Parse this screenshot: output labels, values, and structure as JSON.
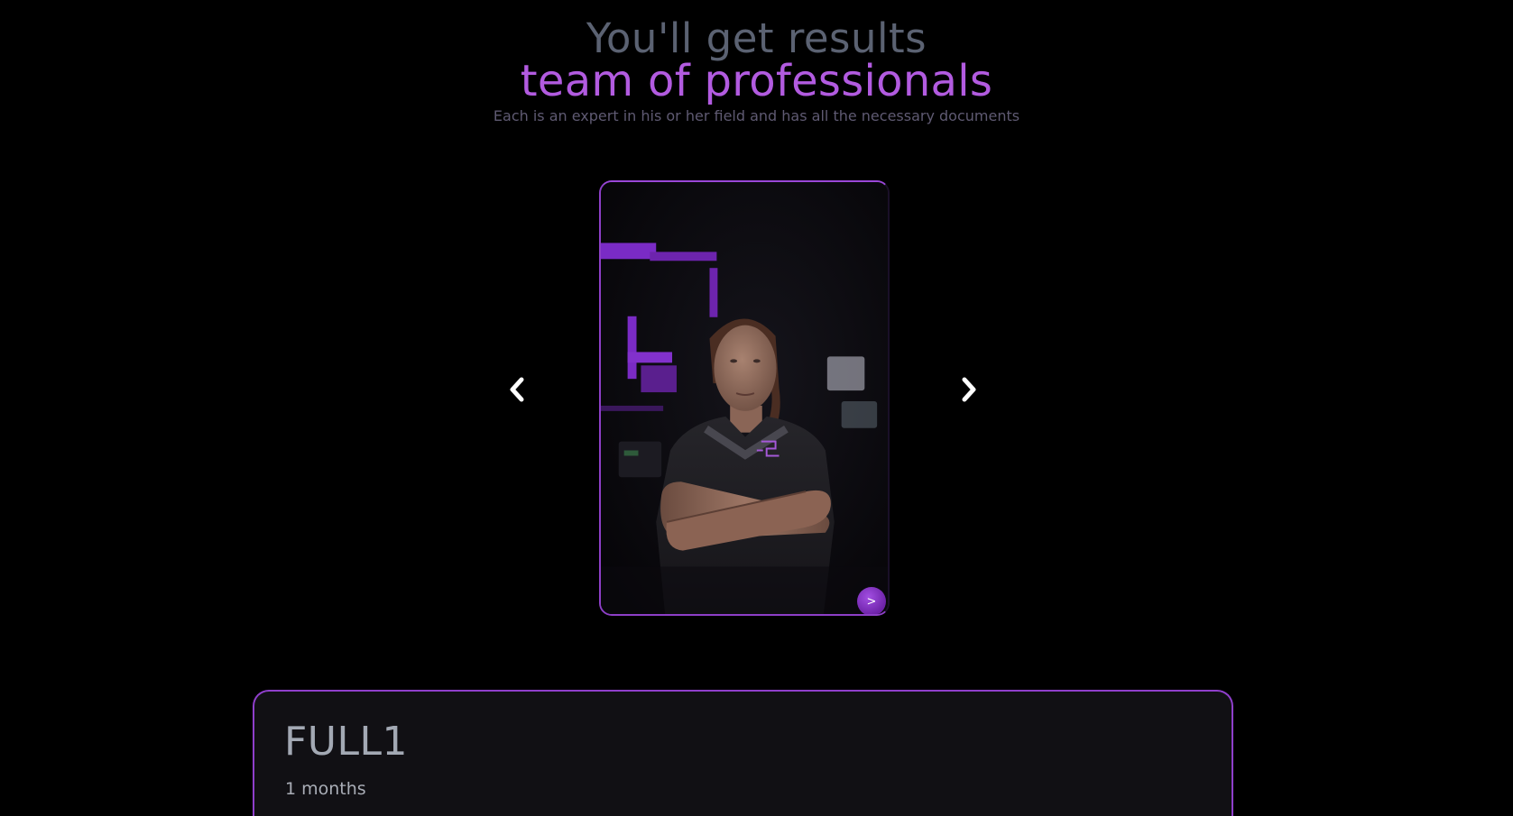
{
  "header": {
    "title": "You'll get results",
    "accent": "team of professionals",
    "description": "Each is an expert in his or her field and has all the necessary documents"
  },
  "carousel": {
    "prev_icon": "chevron-left-icon",
    "next_icon": "chevron-right-icon",
    "card": {
      "photo_subject": "trainer-photo",
      "go_button_label": ">"
    }
  },
  "plan": {
    "name": "FULL1",
    "duration": "1 months"
  },
  "colors": {
    "background": "#000000",
    "accent": "#b25be0",
    "title": "#5b6272",
    "card_border": "#8d3fc7",
    "plan_background": "#111014"
  }
}
